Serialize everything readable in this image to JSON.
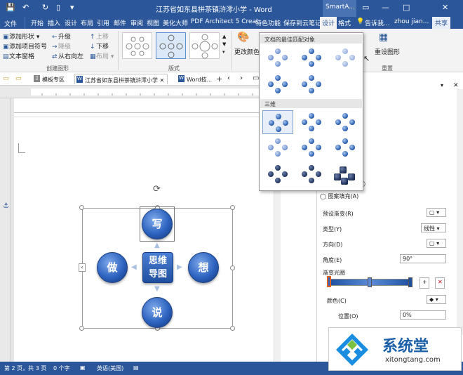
{
  "window": {
    "doc_title": "江苏省如东县栟茶镇浒澪小学 - Word",
    "context_tool": "SmartA..."
  },
  "tabs": {
    "file": "文件",
    "items": [
      "开始",
      "插入",
      "设计",
      "布局",
      "引用",
      "邮件",
      "审阅",
      "视图",
      "美化大师",
      "PDF Architect 5 Creat",
      "特色功能",
      "保存到云笔记",
      "设计",
      "格式"
    ],
    "tell_me": "告诉我...",
    "user": "zhou jian...",
    "share": "共享"
  },
  "ribbon": {
    "add_shape": "添加形状",
    "add_bullet": "添加项目符号",
    "text_pane": "文本窗格",
    "promote": "升级",
    "demote": "降级",
    "right_to_left": "从右向左",
    "move_up": "上移",
    "move_down": "下移",
    "layout": "布局",
    "group_create": "创建图形",
    "group_layouts": "版式",
    "change_colors": "更改颜色",
    "reset_graphic": "重设图形",
    "group_reset": "重置"
  },
  "dropdown": {
    "section1": "文档的最佳匹配对象",
    "section2": "三维"
  },
  "doctabs": {
    "template": "模板专区",
    "current": "江苏省如东县栟茶镇浒澪小学",
    "word": "Word技..."
  },
  "smartart": {
    "top": "写",
    "left": "做",
    "right": "想",
    "bottom": "说",
    "center_line1": "思维",
    "center_line2": "导图"
  },
  "pane": {
    "pattern_fill": "图案填充(A)",
    "preset_gradient": "预设渐变(R)",
    "type": "类型(Y)",
    "type_value": "线性",
    "direction": "方向(D)",
    "angle": "角度(E)",
    "angle_value": "90°",
    "gradient_stops": "渐变光圈",
    "color": "颜色(C)",
    "position": "位置(O)",
    "position_value": "0%"
  },
  "status": {
    "page": "第 2 页，共 3 页",
    "words": "0 个字",
    "lang": "英语(美国)"
  },
  "watermark": {
    "brand": "系统堂",
    "url": "xitongtang.com"
  },
  "colors": {
    "word_blue": "#2b579a",
    "sphere_blue": "#2d63c0"
  }
}
